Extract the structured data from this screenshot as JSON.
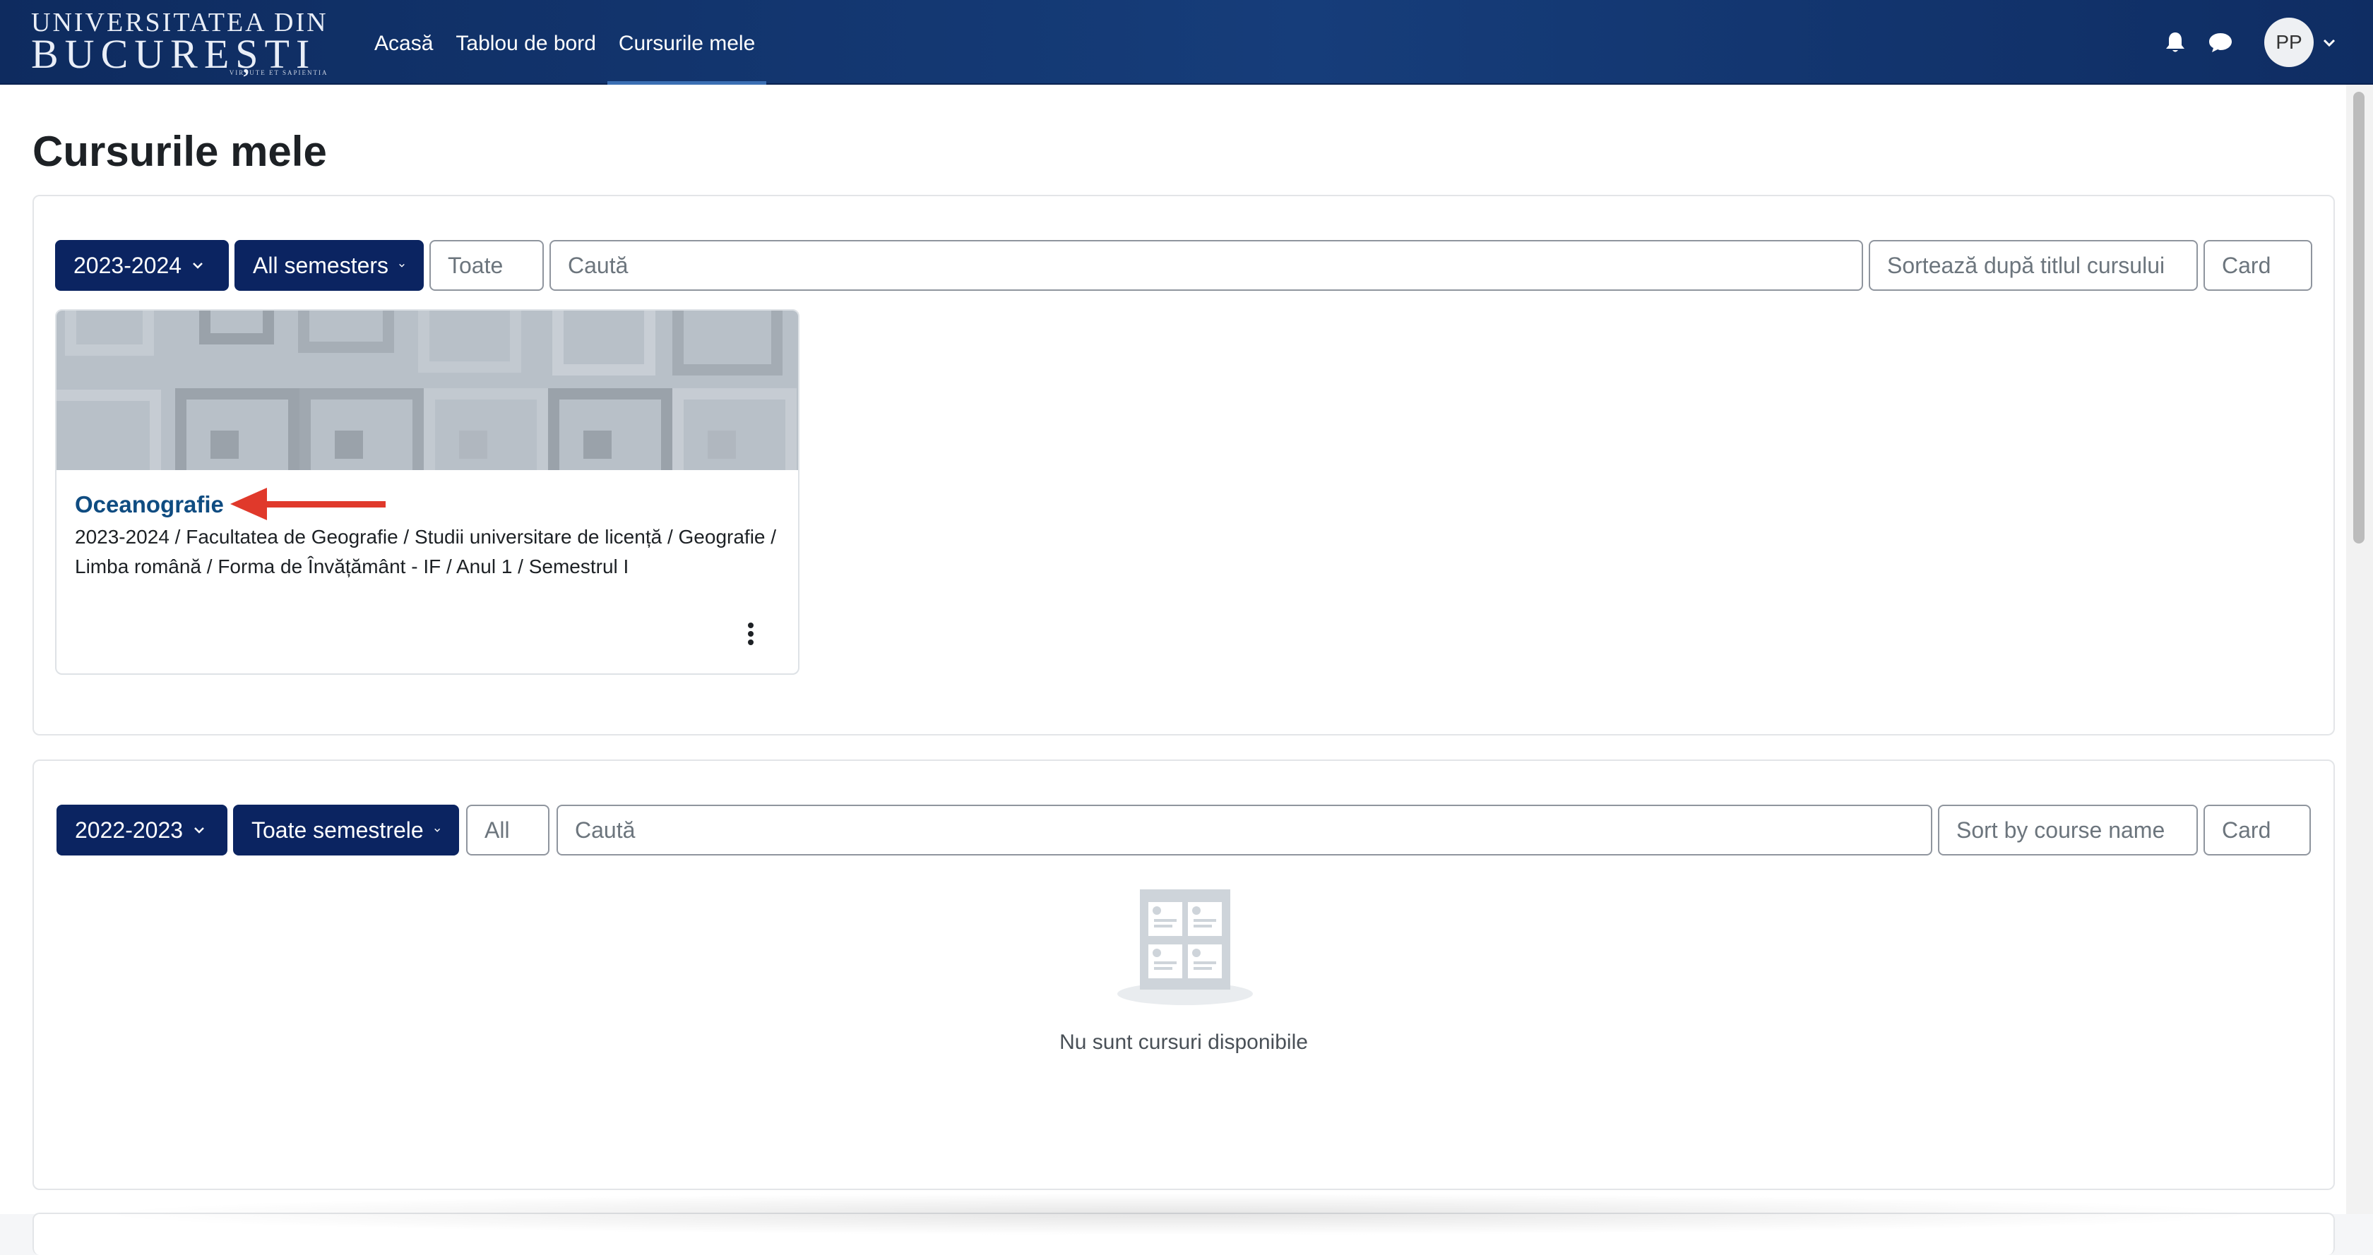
{
  "header": {
    "logo": {
      "line1": "UNIVERSITATEA DIN",
      "line2": "BUCUREȘTI",
      "motto": "VIRTUTE ET SAPIENTIA"
    },
    "nav": [
      {
        "label": "Acasă"
      },
      {
        "label": "Tablou de bord"
      },
      {
        "label": "Cursurile mele",
        "active": true
      }
    ],
    "icons": [
      "bell-icon",
      "chat-icon"
    ],
    "user_initials": "PP",
    "colors": {
      "navbar": "#163d7a",
      "active_underline": "#3b6fb3"
    }
  },
  "page": {
    "title": "Cursurile mele"
  },
  "sections": [
    {
      "year": "2023-2024",
      "semester": "All semesters",
      "grouping": "Toate",
      "search_placeholder": "Caută",
      "sort": "Sortează după titlul cursului",
      "view": "Card",
      "courses": [
        {
          "name": "Oceanografie",
          "path": "2023-2024 / Facultatea de Geografie / Studii universitare de licență / Geografie / Limba română / Forma de Învățământ - IF / Anul 1 / Semestrul I"
        }
      ]
    },
    {
      "year": "2022-2023",
      "semester": "Toate semestrele",
      "grouping": "All",
      "search_placeholder": "Caută",
      "sort": "Sort by course name",
      "view": "Card",
      "empty_message": "Nu sunt cursuri disponibile"
    }
  ],
  "colors": {
    "primary_button": "#0b2461",
    "course_link": "#0f4c81",
    "annotation_arrow": "#e0392b"
  }
}
